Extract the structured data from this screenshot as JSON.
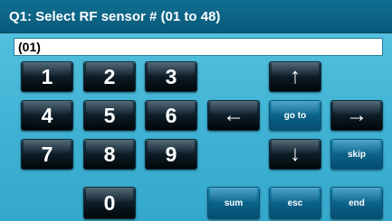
{
  "title": "Q1: Select RF sensor # (01 to 48)",
  "entry": {
    "value": "(01)"
  },
  "digits": [
    "1",
    "2",
    "3",
    "4",
    "5",
    "6",
    "7",
    "8",
    "9",
    "0"
  ],
  "arrows": {
    "up": "↑",
    "down": "↓",
    "left": "←",
    "right": "→"
  },
  "buttons": {
    "goto": "go to",
    "skip": "skip",
    "sum": "sum",
    "esc": "esc",
    "end": "end"
  }
}
